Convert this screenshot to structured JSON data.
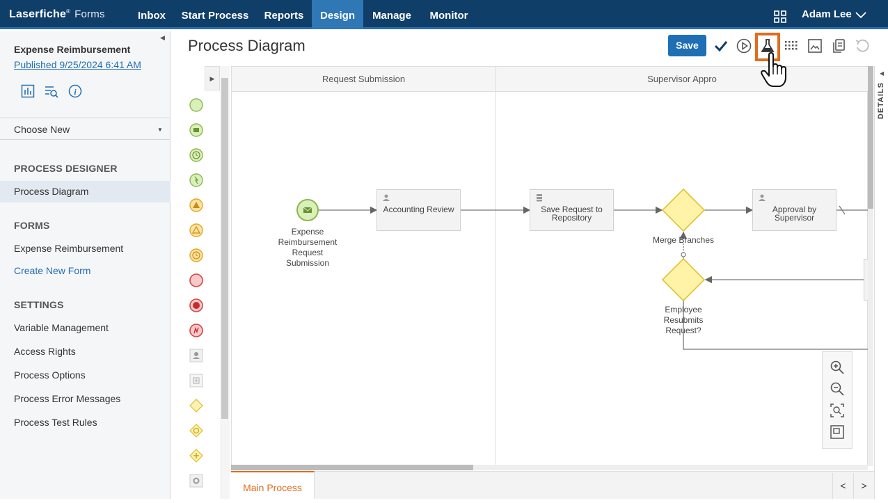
{
  "header": {
    "brand": "Laserfiche",
    "product": "Forms",
    "nav": [
      {
        "label": "Inbox"
      },
      {
        "label": "Start Process"
      },
      {
        "label": "Reports"
      },
      {
        "label": "Design",
        "active": true
      },
      {
        "label": "Manage"
      },
      {
        "label": "Monitor"
      }
    ],
    "user": "Adam Lee"
  },
  "sidebar": {
    "process_name": "Expense Reimbursement",
    "published": "Published 9/25/2024 6:41 AM",
    "icons": [
      "report-chart-icon",
      "search-list-icon",
      "info-icon"
    ],
    "choose_new": "Choose New",
    "sections": {
      "designer": {
        "heading": "PROCESS DESIGNER",
        "items": [
          "Process Diagram"
        ]
      },
      "forms": {
        "heading": "FORMS",
        "items": [
          "Expense Reimbursement",
          "Create New Form"
        ]
      },
      "settings": {
        "heading": "SETTINGS",
        "items": [
          "Variable Management",
          "Access Rights",
          "Process Options",
          "Process Error Messages",
          "Process Test Rules"
        ]
      }
    }
  },
  "main": {
    "title": "Process Diagram",
    "toolbar": {
      "save": "Save",
      "icons": [
        "validate-check-icon",
        "run-play-icon",
        "test-flask-icon",
        "grid-icon",
        "image-export-icon",
        "copy-icon",
        "undo-icon"
      ],
      "highlighted": "test-flask-icon"
    },
    "lanes": [
      {
        "label": "Request Submission"
      },
      {
        "label": "Supervisor Appro"
      }
    ],
    "nodes": {
      "start_event_label": "Expense\nReimbursement\nRequest\nSubmission",
      "accounting_review": "Accounting Review",
      "save_request": "Save Request to\nRepository",
      "merge_label": "Merge Branches",
      "approval": "Approval by\nSupervisor",
      "resubmit_label": "Employee\nResubmits\nRequest?"
    },
    "details_label": "DETAILS",
    "tabs": [
      {
        "label": "Main Process",
        "active": true
      }
    ],
    "pager": {
      "prev": "<",
      "next": ">"
    }
  },
  "colors": {
    "nav_bg": "#0f3e68",
    "nav_active": "#2f77b5",
    "accent_orange": "#e36b1c",
    "save_blue": "#1f6fb5"
  }
}
